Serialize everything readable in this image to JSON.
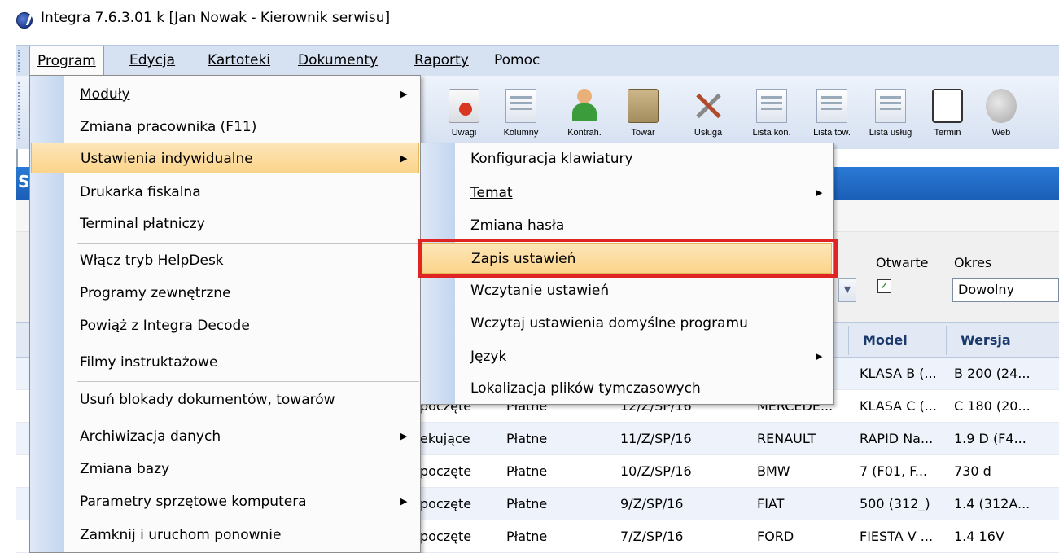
{
  "window": {
    "title": "Integra 7.6.3.01 k [Jan Nowak - Kierownik serwisu]"
  },
  "menubar": [
    "Program",
    "Edycja",
    "Kartoteki",
    "Dokumenty",
    "Raporty",
    "Pomoc"
  ],
  "toolbar": [
    {
      "label": "Uwagi",
      "icon": "warning-doc-icon"
    },
    {
      "label": "Kolumny",
      "icon": "columns-icon"
    },
    {
      "label": "Kontrah.",
      "icon": "contractor-icon"
    },
    {
      "label": "Towar",
      "icon": "goods-box-icon"
    },
    {
      "label": "Usługa",
      "icon": "tools-icon"
    },
    {
      "label": "Lista kon.",
      "icon": "contractor-list-icon"
    },
    {
      "label": "Lista tow.",
      "icon": "goods-list-icon"
    },
    {
      "label": "Lista usług",
      "icon": "services-list-icon"
    },
    {
      "label": "Termin",
      "icon": "schedule-icon"
    },
    {
      "label": "Web",
      "icon": "globe-icon"
    }
  ],
  "program_menu": [
    {
      "label": "Moduły",
      "submenu": true
    },
    {
      "label": "Zmiana pracownika (F11)",
      "submenu": false
    },
    {
      "label": "Ustawienia indywidualne",
      "submenu": true
    },
    {
      "label": "Drukarka fiskalna",
      "submenu": false
    },
    {
      "label": "Terminal płatniczy",
      "submenu": false
    },
    {
      "label": "Włącz tryb HelpDesk",
      "submenu": false
    },
    {
      "label": "Programy zewnętrzne",
      "submenu": false
    },
    {
      "label": "Powiąż z Integra Decode",
      "submenu": false
    },
    {
      "label": "Filmy instruktażowe",
      "submenu": false
    },
    {
      "label": "Usuń blokady dokumentów, towarów",
      "submenu": false
    },
    {
      "label": "Archiwizacja danych",
      "submenu": true
    },
    {
      "label": "Zmiana bazy",
      "submenu": false
    },
    {
      "label": "Parametry sprzętowe komputera",
      "submenu": true
    },
    {
      "label": "Zamknij i uruchom ponownie",
      "submenu": false
    }
  ],
  "settings_submenu": [
    {
      "label": "Konfiguracja klawiatury",
      "submenu": false
    },
    {
      "label": "Temat",
      "submenu": true
    },
    {
      "label": "Zmiana hasła",
      "submenu": false
    },
    {
      "label": "Zapis ustawień",
      "submenu": false
    },
    {
      "label": "Wczytanie ustawień",
      "submenu": false
    },
    {
      "label": "Wczytaj ustawienia domyślne programu",
      "submenu": false
    },
    {
      "label": "Język",
      "submenu": true
    },
    {
      "label": "Lokalizacja plików tymczasowych",
      "submenu": false
    }
  ],
  "filters": {
    "otwarte_label": "Otwarte",
    "okres_label": "Okres",
    "okres_value": "Dowolny",
    "otwarte_checked": "✓"
  },
  "table": {
    "headers": [
      "Model",
      "Wersja"
    ],
    "rows": [
      [
        "",
        "",
        "",
        "...",
        "KLASA B (...",
        "B 200 (24..."
      ],
      [
        "poczęte",
        "Płatne",
        "12/Z/SP/16",
        "MERCEDE...",
        "KLASA C (...",
        "C 180 (20..."
      ],
      [
        "ekujące",
        "Płatne",
        "11/Z/SP/16",
        "RENAULT",
        "RAPID Na...",
        "1.9 D (F4..."
      ],
      [
        "poczęte",
        "Płatne",
        "10/Z/SP/16",
        "BMW",
        "7 (F01, F...",
        "730 d"
      ],
      [
        "poczęte",
        "Płatne",
        "9/Z/SP/16",
        "FIAT",
        "500 (312_)",
        "1.4 (312A..."
      ],
      [
        "poczęte",
        "Płatne",
        "7/Z/SP/16",
        "FORD",
        "FIESTA V ...",
        "1.4 16V"
      ]
    ]
  },
  "colors": {
    "menubar_bg": "#d6e1f2",
    "highlight": "#fbd48a",
    "callout": "#e02424",
    "inner_title": "#2a79d6"
  }
}
